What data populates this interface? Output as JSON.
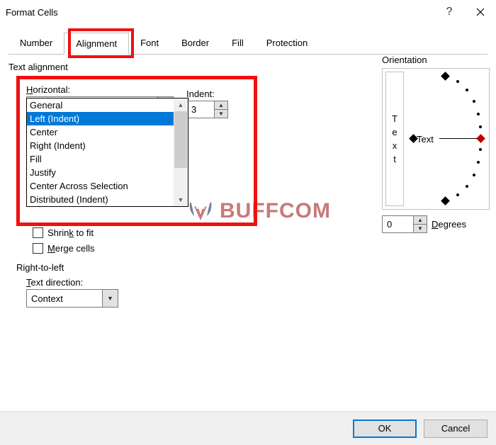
{
  "title": "Format Cells",
  "tabs": [
    "Number",
    "Alignment",
    "Font",
    "Border",
    "Fill",
    "Protection"
  ],
  "active_tab": 1,
  "text_alignment": {
    "group_label": "Text alignment",
    "horizontal_label": "Horizontal:",
    "horizontal_value": "Left (Indent)",
    "indent_label": "Indent:",
    "indent_value": "3",
    "options": [
      "General",
      "Left (Indent)",
      "Center",
      "Right (Indent)",
      "Fill",
      "Justify",
      "Center Across Selection",
      "Distributed (Indent)"
    ],
    "selected_index": 1
  },
  "text_control": {
    "shrink_label": "Shrink to fit",
    "merge_label": "Merge cells"
  },
  "rtl": {
    "group_label": "Right-to-left",
    "text_direction_label": "Text direction:",
    "text_direction_value": "Context"
  },
  "orientation": {
    "group_label": "Orientation",
    "vertical_text": [
      "T",
      "e",
      "x",
      "t"
    ],
    "dial_text": "Text",
    "degrees_value": "0",
    "degrees_label": "Degrees"
  },
  "buttons": {
    "ok": "OK",
    "cancel": "Cancel"
  },
  "watermark": "BUFFCOM"
}
